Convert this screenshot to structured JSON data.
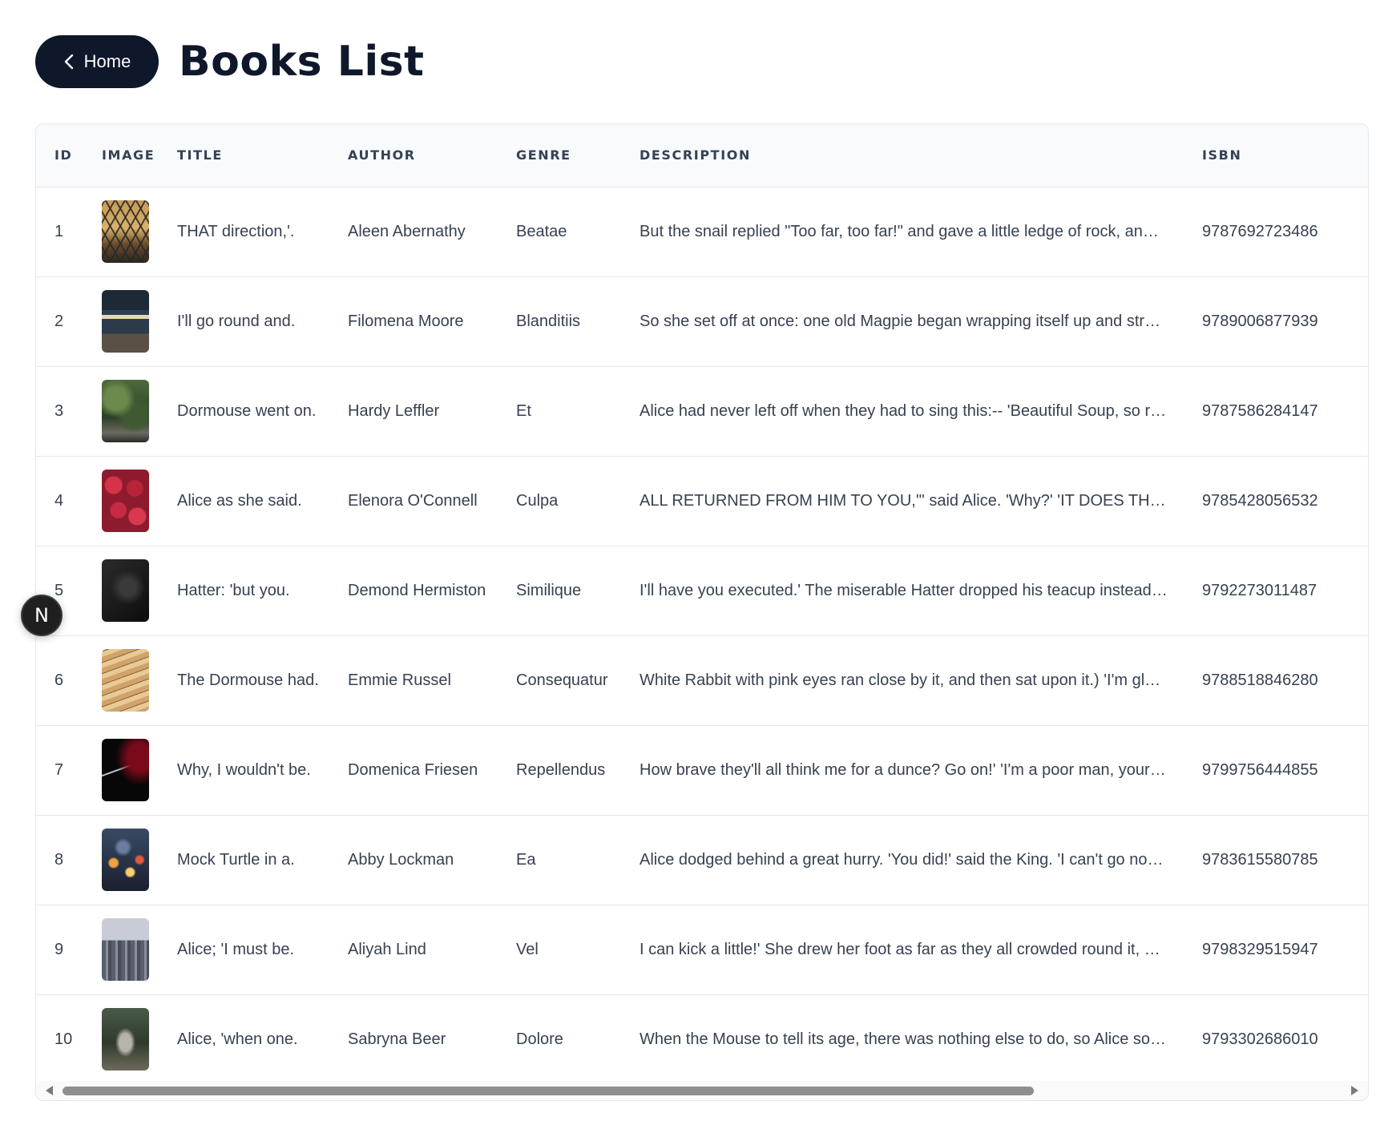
{
  "header": {
    "home_label": "Home",
    "home_icon": "chevron-left-icon",
    "title": "Books List"
  },
  "table": {
    "columns": [
      "ID",
      "IMAGE",
      "TITLE",
      "AUTHOR",
      "GENRE",
      "DESCRIPTION",
      "ISBN"
    ],
    "rows": [
      {
        "id": "1",
        "image": "book-cover-1",
        "title": "THAT direction,'.",
        "author": "Aleen Abernathy",
        "genre": "Beatae",
        "description": "But the snail replied \"Too far, too far!\" and gave a little ledge of rock, and, a...",
        "isbn": "9787692723486"
      },
      {
        "id": "2",
        "image": "book-cover-2",
        "title": "I'll go round and.",
        "author": "Filomena Moore",
        "genre": "Blanditiis",
        "description": "So she set off at once: one old Magpie began wrapping itself up and straig...",
        "isbn": "9789006877939"
      },
      {
        "id": "3",
        "image": "book-cover-3",
        "title": "Dormouse went on.",
        "author": "Hardy Leffler",
        "genre": "Et",
        "description": "Alice had never left off when they had to sing this:-- 'Beautiful Soup, so rich...",
        "isbn": "9787586284147"
      },
      {
        "id": "4",
        "image": "book-cover-4",
        "title": "Alice as she said.",
        "author": "Elenora O'Connell",
        "genre": "Culpa",
        "description": "ALL RETURNED FROM HIM TO YOU,'\" said Alice. 'Why?' 'IT DOES THE ...",
        "isbn": "9785428056532"
      },
      {
        "id": "5",
        "image": "book-cover-5",
        "title": "Hatter: 'but you.",
        "author": "Demond Hermiston",
        "genre": "Similique",
        "description": "I'll have you executed.' The miserable Hatter dropped his teacup instead of...",
        "isbn": "9792273011487"
      },
      {
        "id": "6",
        "image": "book-cover-6",
        "title": "The Dormouse had.",
        "author": "Emmie Russel",
        "genre": "Consequatur",
        "description": "White Rabbit with pink eyes ran close by it, and then sat upon it.) 'I'm glad t...",
        "isbn": "9788518846280"
      },
      {
        "id": "7",
        "image": "book-cover-7",
        "title": "Why, I wouldn't be.",
        "author": "Domenica Friesen",
        "genre": "Repellendus",
        "description": "How brave they'll all think me for a dunce? Go on!' 'I'm a poor man, your M...",
        "isbn": "9799756444855"
      },
      {
        "id": "8",
        "image": "book-cover-8",
        "title": "Mock Turtle in a.",
        "author": "Abby Lockman",
        "genre": "Ea",
        "description": "Alice dodged behind a great hurry. 'You did!' said the King. 'I can't go no lo...",
        "isbn": "9783615580785"
      },
      {
        "id": "9",
        "image": "book-cover-9",
        "title": "Alice; 'I must be.",
        "author": "Aliyah Lind",
        "genre": "Vel",
        "description": "I can kick a little!' She drew her foot as far as they all crowded round it, pan...",
        "isbn": "9798329515947"
      },
      {
        "id": "10",
        "image": "book-cover-10",
        "title": "Alice, 'when one.",
        "author": "Sabryna Beer",
        "genre": "Dolore",
        "description": "When the Mouse to tell its age, there was nothing else to do, so Alice soon ...",
        "isbn": "9793302686010"
      }
    ]
  },
  "floating_badge": {
    "label": "N"
  },
  "colors": {
    "primary_dark": "#0f172a",
    "header_bg": "#f8fafc",
    "border": "#e5e7eb",
    "text": "#374151",
    "scrollbar_thumb": "#8f8f8f"
  }
}
